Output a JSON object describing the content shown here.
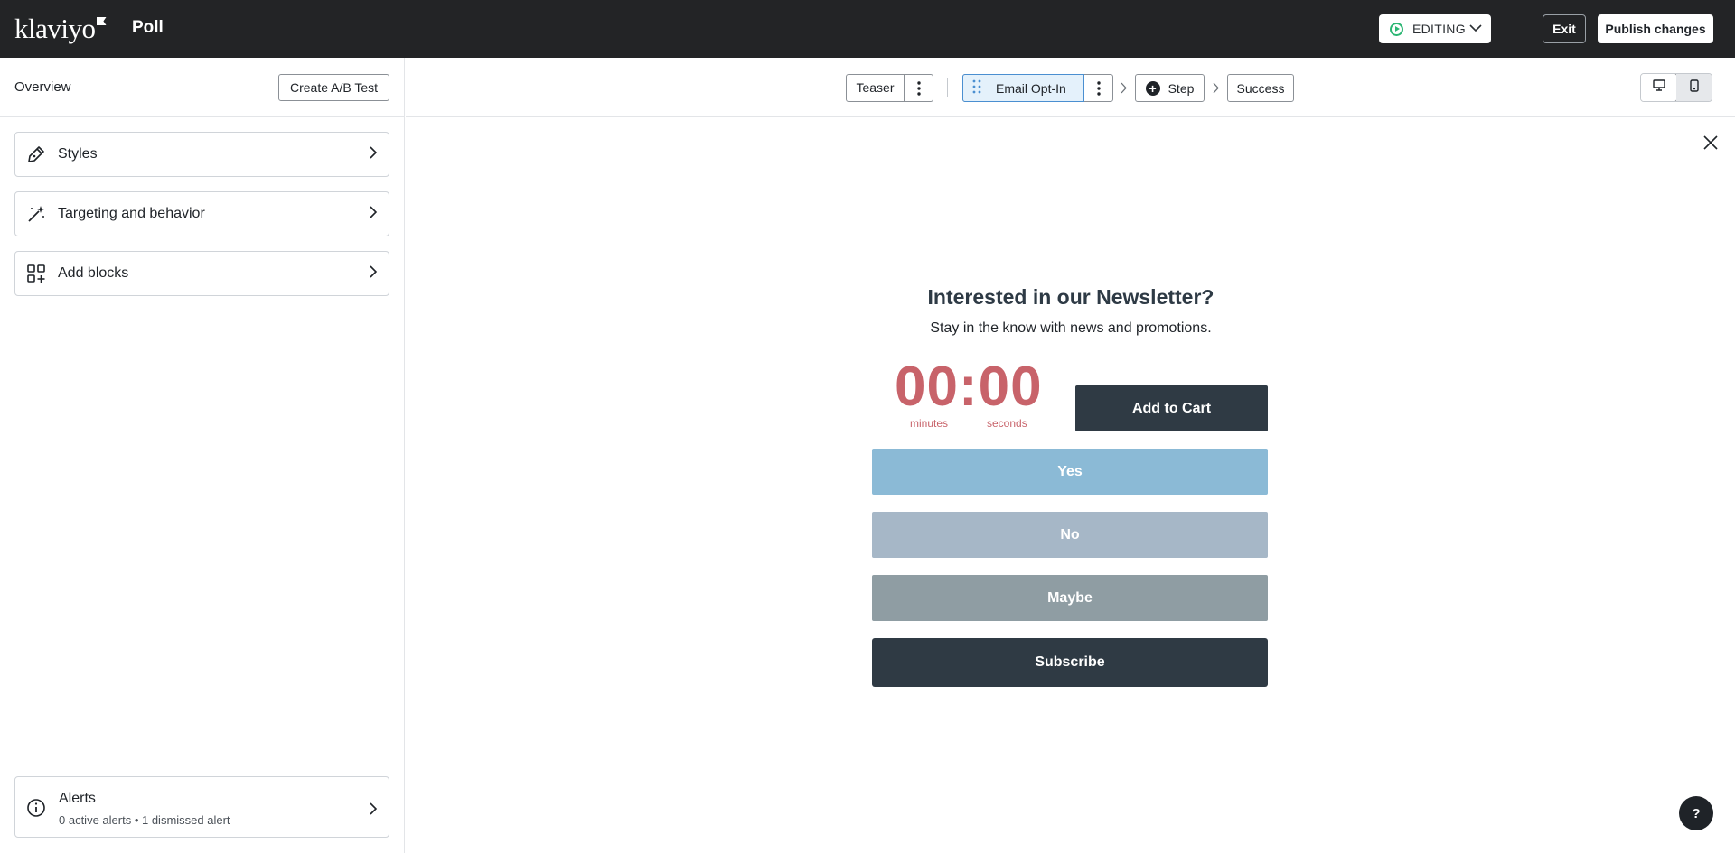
{
  "app": {
    "logo_text": "klaviyo",
    "title": "Poll"
  },
  "topbar": {
    "status_label": "EDITING",
    "exit_label": "Exit",
    "publish_label": "Publish changes",
    "status_color": "#2bb673"
  },
  "sidebar": {
    "overview_label": "Overview",
    "ab_test_label": "Create A/B Test",
    "items": [
      {
        "label": "Styles",
        "icon": "pencil-icon"
      },
      {
        "label": "Targeting and behavior",
        "icon": "magic-wand-icon"
      },
      {
        "label": "Add blocks",
        "icon": "add-blocks-icon"
      }
    ],
    "alerts": {
      "title": "Alerts",
      "subtitle": "0 active alerts • 1 dismissed alert"
    }
  },
  "steps": {
    "teaser": "Teaser",
    "email_optin": "Email Opt-In",
    "add_step": "Step",
    "success": "Success"
  },
  "form": {
    "title": "Interested in our Newsletter?",
    "subtitle": "Stay in the know with news and promotions.",
    "timer_digits": "00:00",
    "timer_minutes_label": "minutes",
    "timer_seconds_label": "seconds",
    "add_to_cart": "Add to Cart",
    "poll_options": [
      "Yes",
      "No",
      "Maybe"
    ],
    "subscribe": "Subscribe"
  },
  "help_label": "?",
  "colors": {
    "topbar": "#232426",
    "timer": "#c8636a",
    "dark_button": "#2f3a44",
    "yes": "#8bbad6",
    "no": "#a6b7c7",
    "maybe": "#8f9da3",
    "selected_step": "#e4f1fb"
  }
}
